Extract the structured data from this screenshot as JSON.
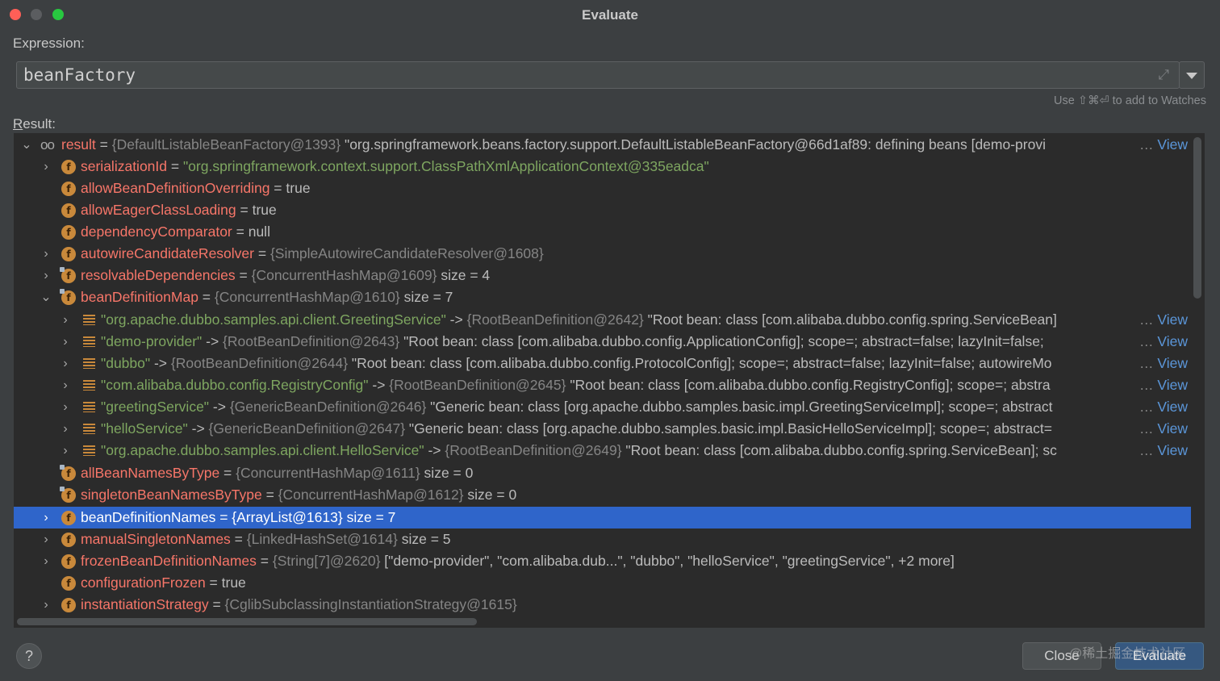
{
  "window": {
    "title": "Evaluate"
  },
  "expression": {
    "label": "Expression:",
    "value": "beanFactory"
  },
  "hint": "Use ⇧⌘⏎ to add to Watches",
  "result": {
    "label_first": "R",
    "label_rest": "esult:"
  },
  "rows": [
    {
      "name": "result",
      "op": " = ",
      "type": "{DefaultListableBeanFactory@1393}",
      "text": " \"org.springframework.beans.factory.support.DefaultListableBeanFactory@66d1af89: defining beans [demo-provi",
      "view": "View"
    },
    {
      "name": "serializationId",
      "op": " = ",
      "str": "\"org.springframework.context.support.ClassPathXmlApplicationContext@335eadca\""
    },
    {
      "name": "allowBeanDefinitionOverriding",
      "op": " = ",
      "text": "true"
    },
    {
      "name": "allowEagerClassLoading",
      "op": " = ",
      "text": "true"
    },
    {
      "name": "dependencyComparator",
      "op": " = ",
      "text": "null"
    },
    {
      "name": "autowireCandidateResolver",
      "op": " = ",
      "type": "{SimpleAutowireCandidateResolver@1608}"
    },
    {
      "name": "resolvableDependencies",
      "op": " = ",
      "type": "{ConcurrentHashMap@1609}",
      "text": "  size = 4"
    },
    {
      "name": "beanDefinitionMap",
      "op": " = ",
      "type": "{ConcurrentHashMap@1610}",
      "text": "  size = 7"
    },
    {
      "key": "\"org.apache.dubbo.samples.api.client.GreetingService\"",
      "op": " -> ",
      "type": "{RootBeanDefinition@2642}",
      "text": " \"Root bean: class [com.alibaba.dubbo.config.spring.ServiceBean]",
      "view": "View"
    },
    {
      "key": "\"demo-provider\"",
      "op": " -> ",
      "type": "{RootBeanDefinition@2643}",
      "text": " \"Root bean: class [com.alibaba.dubbo.config.ApplicationConfig]; scope=; abstract=false; lazyInit=false;",
      "view": "View"
    },
    {
      "key": "\"dubbo\"",
      "op": " -> ",
      "type": "{RootBeanDefinition@2644}",
      "text": " \"Root bean: class [com.alibaba.dubbo.config.ProtocolConfig]; scope=; abstract=false; lazyInit=false; autowireMo",
      "view": "View"
    },
    {
      "key": "\"com.alibaba.dubbo.config.RegistryConfig\"",
      "op": " -> ",
      "type": "{RootBeanDefinition@2645}",
      "text": " \"Root bean: class [com.alibaba.dubbo.config.RegistryConfig]; scope=; abstra",
      "view": "View"
    },
    {
      "key": "\"greetingService\"",
      "op": " -> ",
      "type": "{GenericBeanDefinition@2646}",
      "text": " \"Generic bean: class [org.apache.dubbo.samples.basic.impl.GreetingServiceImpl]; scope=; abstract",
      "view": "View"
    },
    {
      "key": "\"helloService\"",
      "op": " -> ",
      "type": "{GenericBeanDefinition@2647}",
      "text": " \"Generic bean: class [org.apache.dubbo.samples.basic.impl.BasicHelloServiceImpl]; scope=; abstract=",
      "view": "View"
    },
    {
      "key": "\"org.apache.dubbo.samples.api.client.HelloService\"",
      "op": " -> ",
      "type": "{RootBeanDefinition@2649}",
      "text": " \"Root bean: class [com.alibaba.dubbo.config.spring.ServiceBean]; sc",
      "view": "View"
    },
    {
      "name": "allBeanNamesByType",
      "op": " = ",
      "type": "{ConcurrentHashMap@1611}",
      "text": "  size = 0"
    },
    {
      "name": "singletonBeanNamesByType",
      "op": " = ",
      "type": "{ConcurrentHashMap@1612}",
      "text": "  size = 0"
    },
    {
      "name": "beanDefinitionNames",
      "op": " = ",
      "type": "{ArrayList@1613}",
      "text": "  size = 7"
    },
    {
      "name": "manualSingletonNames",
      "op": " = ",
      "type": "{LinkedHashSet@1614}",
      "text": "  size = 5"
    },
    {
      "name": "frozenBeanDefinitionNames",
      "op": " = ",
      "type": "{String[7]@2620}",
      "text": " [\"demo-provider\", \"com.alibaba.dub...\", \"dubbo\", \"helloService\", \"greetingService\", +2 more]"
    },
    {
      "name": "configurationFrozen",
      "op": " = ",
      "text": "true"
    },
    {
      "name": "instantiationStrategy",
      "op": " = ",
      "type": "{CglibSubclassingInstantiationStrategy@1615}"
    }
  ],
  "buttons": {
    "close": "Close",
    "evaluate": "Evaluate",
    "help": "?"
  },
  "watermark": "@稀土掘金技术社区"
}
